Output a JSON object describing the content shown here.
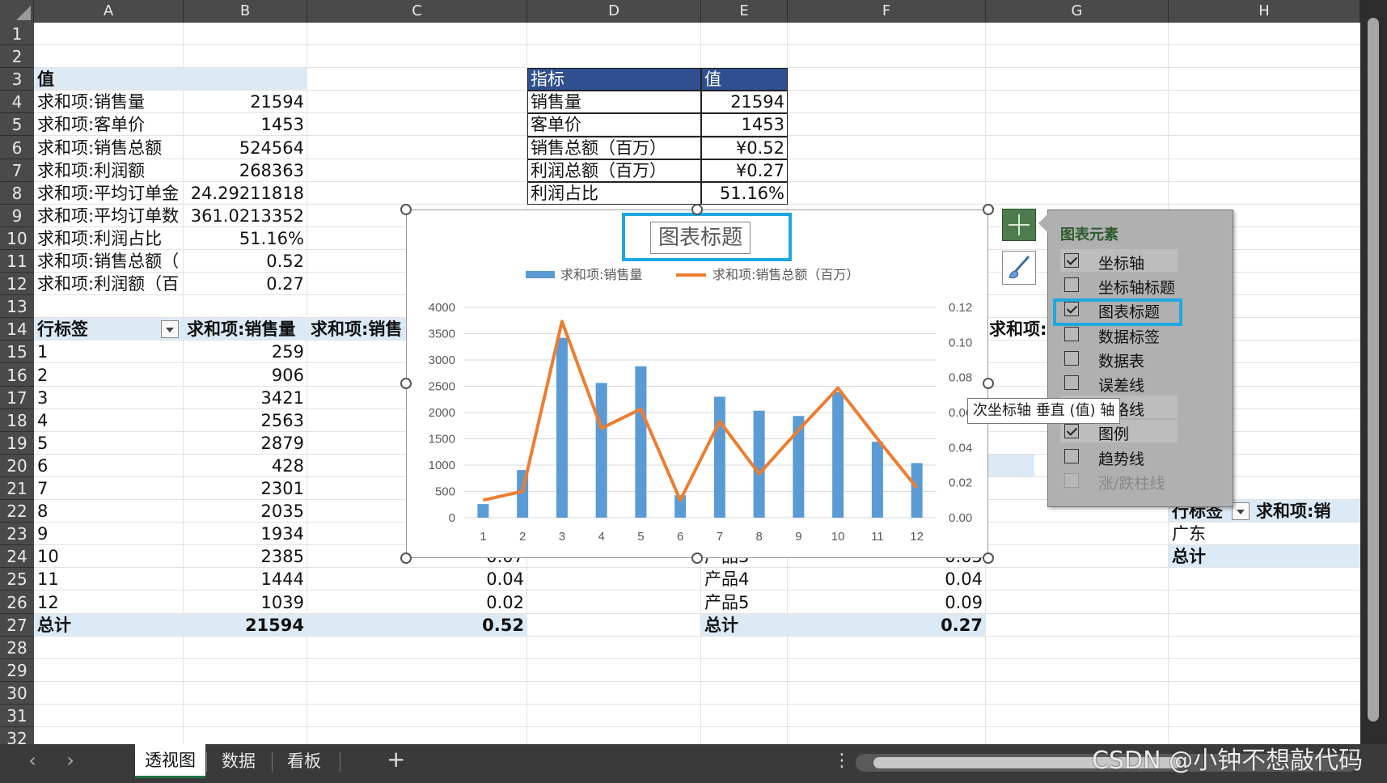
{
  "columns": [
    "A",
    "B",
    "C",
    "D",
    "E",
    "F",
    "G",
    "H"
  ],
  "rows": [
    "1",
    "2",
    "3",
    "4",
    "5",
    "6",
    "7",
    "8",
    "9",
    "10",
    "11",
    "12",
    "13",
    "14",
    "15",
    "16",
    "17",
    "18",
    "19",
    "20",
    "21",
    "22",
    "23",
    "24",
    "25",
    "26",
    "27",
    "28",
    "29",
    "30",
    "31",
    "32"
  ],
  "summary": {
    "header": "值",
    "items": [
      {
        "label": "求和项:销售量",
        "value": "21594"
      },
      {
        "label": "求和项:客单价",
        "value": "1453"
      },
      {
        "label": "求和项:销售总额",
        "value": "524564"
      },
      {
        "label": "求和项:利润额",
        "value": "268363"
      },
      {
        "label": "求和项:平均订单金",
        "value": "24.29211818"
      },
      {
        "label": "求和项:平均订单数",
        "value": "361.0213352"
      },
      {
        "label": "求和项:利润占比",
        "value": "51.16%"
      },
      {
        "label": "求和项:销售总额（",
        "value": "0.52"
      },
      {
        "label": "求和项:利润额（百",
        "value": "0.27"
      }
    ]
  },
  "kpi": {
    "header_metric": "指标",
    "header_value": "值",
    "items": [
      {
        "label": "销售量",
        "value": "21594"
      },
      {
        "label": "客单价",
        "value": "1453"
      },
      {
        "label": "销售总额（百万）",
        "value": "¥0.52"
      },
      {
        "label": "利润总额（百万）",
        "value": "¥0.27"
      },
      {
        "label": "利润占比",
        "value": "51.16%"
      }
    ]
  },
  "pivot": {
    "row_label_header": "行标签",
    "col_b_header": "求和项:销售量",
    "col_c_header": "求和项:销售",
    "rows": [
      {
        "label": "1",
        "sales": "259"
      },
      {
        "label": "2",
        "sales": "906"
      },
      {
        "label": "3",
        "sales": "3421"
      },
      {
        "label": "4",
        "sales": "2563"
      },
      {
        "label": "5",
        "sales": "2879"
      },
      {
        "label": "6",
        "sales": "428"
      },
      {
        "label": "7",
        "sales": "2301"
      },
      {
        "label": "8",
        "sales": "2035"
      },
      {
        "label": "9",
        "sales": "1934"
      },
      {
        "label": "10",
        "sales": "2385",
        "amount": "0.07"
      },
      {
        "label": "11",
        "sales": "1444",
        "amount": "0.04"
      },
      {
        "label": "12",
        "sales": "1039",
        "amount": "0.02"
      }
    ],
    "total_label": "总计",
    "total_sales": "21594",
    "total_amount": "0.52"
  },
  "product_pivot": {
    "header_partial": "求和项:",
    "rows": [
      {
        "label": "产品3",
        "value": "0.05"
      },
      {
        "label": "产品4",
        "value": "0.04"
      },
      {
        "label": "产品5",
        "value": "0.09"
      }
    ],
    "total_label": "总计",
    "total_value": "0.27"
  },
  "region_pivot": {
    "row_label_header": "行标签",
    "value_header": "求和项:销",
    "rows": [
      {
        "label": "广东"
      }
    ],
    "total_label": "总计"
  },
  "chart_data": {
    "type": "bar",
    "title": "图表标题",
    "categories": [
      "1",
      "2",
      "3",
      "4",
      "5",
      "6",
      "7",
      "8",
      "9",
      "10",
      "11",
      "12"
    ],
    "series": [
      {
        "name": "求和项:销售量",
        "type": "bar",
        "axis": "primary",
        "color": "#5b9bd5",
        "values": [
          259,
          906,
          3421,
          2563,
          2879,
          428,
          2301,
          2035,
          1934,
          2385,
          1444,
          1039
        ]
      },
      {
        "name": "求和项:销售总额（百万）",
        "type": "line",
        "axis": "secondary",
        "color": "#ed7d31",
        "values": [
          0.01,
          0.015,
          0.112,
          0.051,
          0.062,
          0.01,
          0.055,
          0.025,
          0.05,
          0.074,
          0.045,
          0.017
        ]
      }
    ],
    "y_ticks": [
      "0",
      "500",
      "1000",
      "1500",
      "2000",
      "2500",
      "3000",
      "3500",
      "4000"
    ],
    "y2_ticks": [
      "0.00",
      "0.02",
      "0.04",
      "0.06",
      "0.08",
      "0.10",
      "0.12"
    ],
    "ylim": [
      0,
      4000
    ],
    "y2lim": [
      0,
      0.12
    ],
    "grid": true,
    "legend": "top"
  },
  "chart_elements_panel": {
    "title": "图表元素",
    "items": [
      {
        "label": "坐标轴",
        "checked": true
      },
      {
        "label": "坐标轴标题",
        "checked": false
      },
      {
        "label": "图表标题",
        "checked": true
      },
      {
        "label": "数据标签",
        "checked": false
      },
      {
        "label": "数据表",
        "checked": false
      },
      {
        "label": "误差线",
        "checked": false
      },
      {
        "label": "网格线",
        "checked": true
      },
      {
        "label": "图例",
        "checked": true
      },
      {
        "label": "趋势线",
        "checked": false
      },
      {
        "label": "涨/跌柱线",
        "checked": false,
        "disabled": true
      }
    ]
  },
  "tooltip": "次坐标轴 垂直 (值) 轴",
  "sheets": [
    {
      "name": "透视图",
      "active": true
    },
    {
      "name": "数据",
      "active": false
    },
    {
      "name": "看板",
      "active": false
    }
  ],
  "add_sheet": "+",
  "more": "⋮",
  "nav_prev": "‹",
  "nav_next": "›",
  "watermark": "CSDN @小钟不想敲代码",
  "colors": {
    "bar": "#5b9bd5",
    "line": "#ed7d31",
    "highlight": "#1ea7e1",
    "kpi_header": "#2f4f8f",
    "pivot_band": "#dceaf6"
  }
}
